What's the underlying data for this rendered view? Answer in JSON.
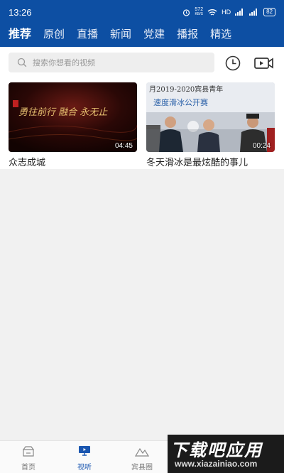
{
  "status_bar": {
    "time": "13:26",
    "net_speed_value": "572",
    "net_speed_unit": "KB/S",
    "hd": "HD",
    "battery": "82"
  },
  "nav_tabs": [
    {
      "label": "推荐",
      "active": true
    },
    {
      "label": "原创"
    },
    {
      "label": "直播"
    },
    {
      "label": "新闻"
    },
    {
      "label": "党建"
    },
    {
      "label": "播报"
    },
    {
      "label": "精选"
    }
  ],
  "search": {
    "placeholder": "搜索你想看的视频"
  },
  "videos": [
    {
      "title": "众志成城",
      "duration": "04:45",
      "thumb_text": "勇往前行 融合 永无止"
    },
    {
      "title": "冬天滑冰是最炫酷的事儿",
      "duration": "00:24",
      "thumb_text_line1": "月2019-2020宾县青年",
      "thumb_text_line2": "速度滑冰公开赛"
    }
  ],
  "bottom_nav": [
    {
      "label": "首页",
      "icon": "home-icon"
    },
    {
      "label": "视听",
      "icon": "tv-icon",
      "active": true
    },
    {
      "label": "宾县圈",
      "icon": "mountain-icon"
    }
  ],
  "watermark": {
    "main": "下载吧应用",
    "sub": "www.xiazainiao.com"
  },
  "colors": {
    "brand": "#0d4fa3",
    "active_tab": "#1a56b0",
    "background": "#f1f1f1"
  }
}
